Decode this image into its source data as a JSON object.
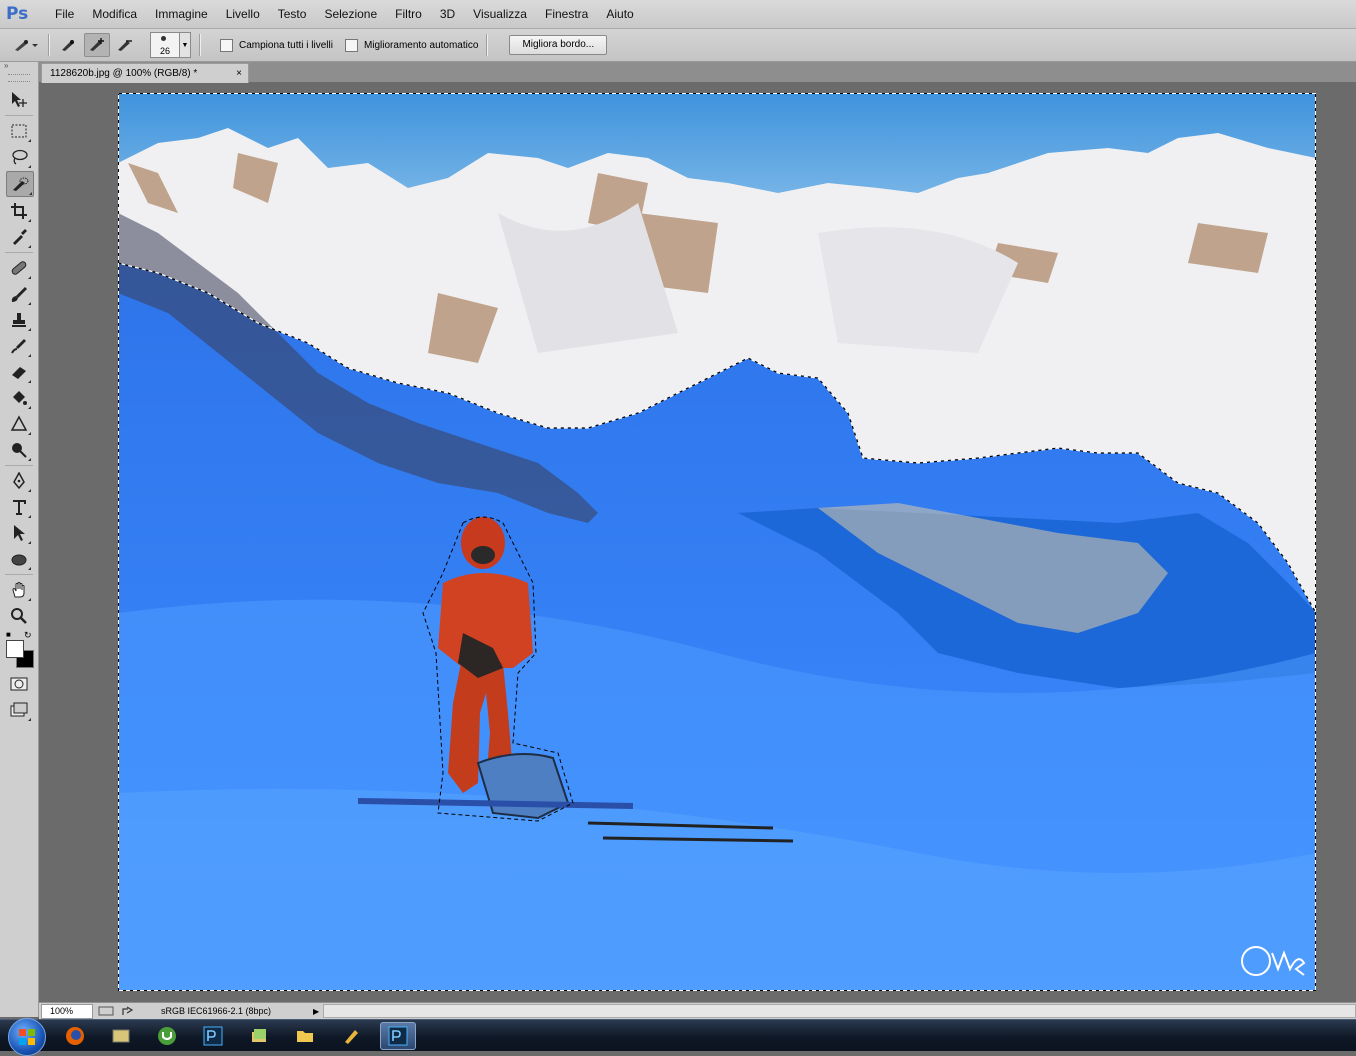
{
  "app": {
    "logo_text": "Ps",
    "menu": [
      "File",
      "Modifica",
      "Immagine",
      "Livello",
      "Testo",
      "Selezione",
      "Filtro",
      "3D",
      "Visualizza",
      "Finestra",
      "Aiuto"
    ]
  },
  "options_bar": {
    "brush_size": "26",
    "sample_all_layers_label": "Campiona tutti i livelli",
    "sample_all_layers_checked": false,
    "auto_enhance_label": "Miglioramento automatico",
    "auto_enhance_checked": false,
    "refine_edge_label": "Migliora bordo..."
  },
  "tools": [
    {
      "name": "move-tool",
      "icon": "move-icon"
    },
    {
      "name": "rect-marquee-tool",
      "icon": "rectangle-marquee-icon"
    },
    {
      "name": "lasso-tool",
      "icon": "lasso-icon"
    },
    {
      "name": "quick-selection-tool",
      "icon": "quick-selection-icon",
      "active": true
    },
    {
      "name": "crop-tool",
      "icon": "crop-icon"
    },
    {
      "name": "eyedropper-tool",
      "icon": "eyedropper-icon"
    },
    {
      "name": "healing-brush-tool",
      "icon": "bandage-icon"
    },
    {
      "name": "brush-tool",
      "icon": "brush-icon"
    },
    {
      "name": "clone-stamp-tool",
      "icon": "stamp-icon"
    },
    {
      "name": "history-brush-tool",
      "icon": "history-brush-icon"
    },
    {
      "name": "eraser-tool",
      "icon": "eraser-icon"
    },
    {
      "name": "paint-bucket-tool",
      "icon": "paint-bucket-icon"
    },
    {
      "name": "blur-tool",
      "icon": "blur-triangle-icon"
    },
    {
      "name": "dodge-tool",
      "icon": "dodge-icon"
    },
    {
      "name": "pen-tool",
      "icon": "pen-icon"
    },
    {
      "name": "type-tool",
      "icon": "type-icon"
    },
    {
      "name": "path-selection-tool",
      "icon": "arrow-select-icon"
    },
    {
      "name": "ellipse-tool",
      "icon": "ellipse-icon"
    },
    {
      "name": "hand-tool",
      "icon": "hand-icon"
    },
    {
      "name": "zoom-tool",
      "icon": "zoom-icon"
    }
  ],
  "colors": {
    "foreground": "#ffffff",
    "background": "#000000",
    "accent": "#3a6ec8"
  },
  "document": {
    "tab_title": "1128620b.jpg @ 100% (RGB/8) *",
    "close_glyph": "×"
  },
  "status": {
    "zoom": "100%",
    "doc_info": "sRGB IEC61966-2.1 (8bpc)"
  },
  "taskbar": {
    "apps": [
      "windows-start",
      "firefox",
      "explorer-window",
      "utorrent",
      "photoshop",
      "folder-stack",
      "file-explorer",
      "pencil-app",
      "photoshop-active"
    ]
  }
}
